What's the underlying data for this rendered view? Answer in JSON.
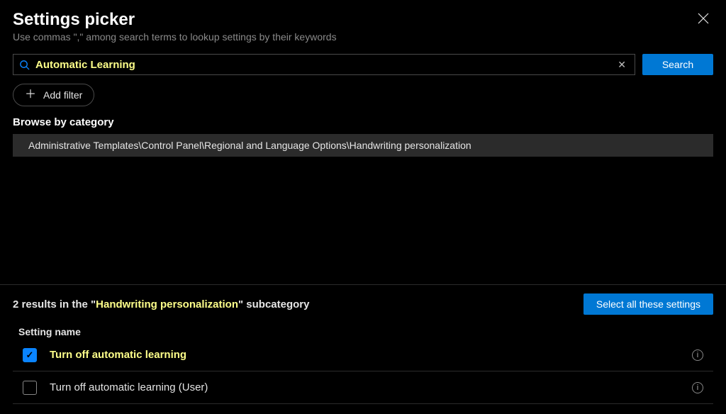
{
  "header": {
    "title": "Settings picker",
    "subtitle": "Use commas \",\" among search terms to lookup settings by their keywords"
  },
  "search": {
    "value": "Automatic Learning",
    "button_label": "Search"
  },
  "add_filter_label": "Add filter",
  "browse_label": "Browse by category",
  "breadcrumb": "Administrative Templates\\Control Panel\\Regional and Language Options\\Handwriting personalization",
  "results": {
    "count": "2",
    "prefix": " results in the \"",
    "subcategory": "Handwriting personalization",
    "suffix": "\" subcategory"
  },
  "select_all_label": "Select all these settings",
  "column_header": "Setting name",
  "rows": [
    {
      "label": "Turn off automatic learning",
      "checked": true,
      "highlighted": true
    },
    {
      "label": "Turn off automatic learning (User)",
      "checked": false,
      "highlighted": false
    }
  ]
}
